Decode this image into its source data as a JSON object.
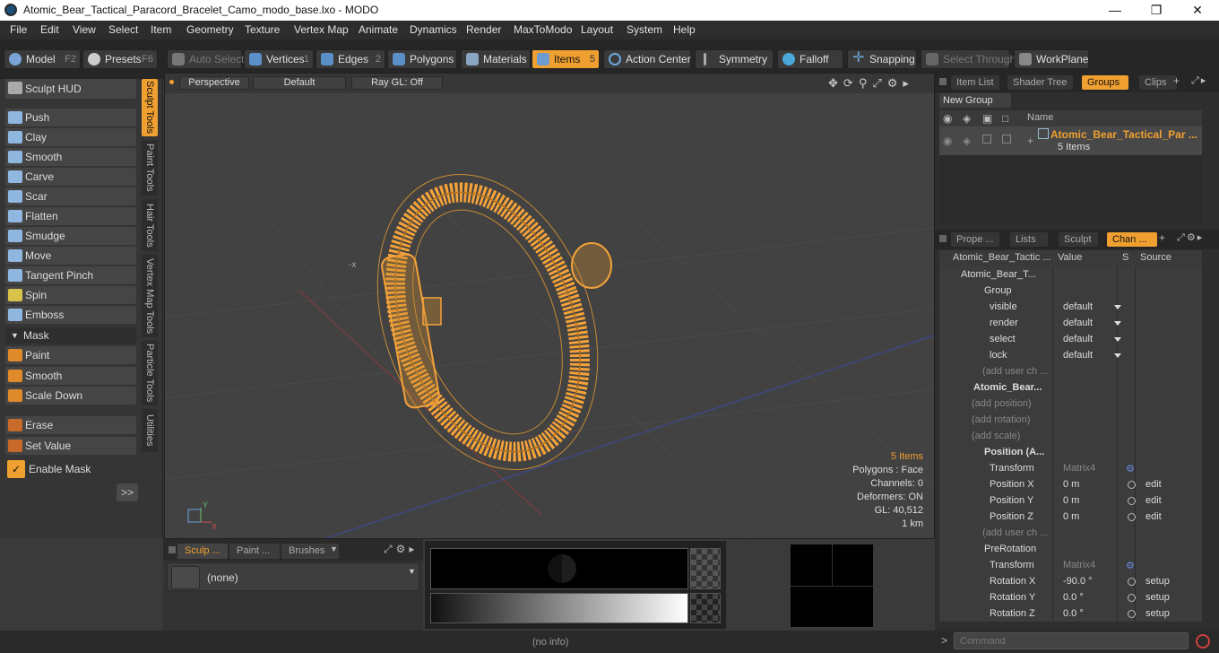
{
  "window": {
    "title": "Atomic_Bear_Tactical_Paracord_Bracelet_Camo_modo_base.lxo - MODO"
  },
  "menu": [
    "File",
    "Edit",
    "View",
    "Select",
    "Item",
    "Geometry",
    "Texture",
    "Vertex Map",
    "Animate",
    "Dynamics",
    "Render",
    "MaxToModo",
    "Layout",
    "System",
    "Help"
  ],
  "toolbar": {
    "model": "Model",
    "model_key": "F2",
    "presets": "Presets",
    "presets_key": "F6",
    "auto_select": "Auto Select",
    "vertices": "Vertices",
    "vertices_key": "1",
    "edges": "Edges",
    "edges_key": "2",
    "polygons": "Polygons",
    "materials": "Materials",
    "items": "Items",
    "items_key": "5",
    "action_center": "Action Center",
    "symmetry": "Symmetry",
    "falloff": "Falloff",
    "snapping": "Snapping",
    "select_through": "Select Through",
    "workplane": "WorkPlane"
  },
  "left": {
    "sculpt_hud": "Sculpt HUD",
    "tools": [
      "Push",
      "Clay",
      "Smooth",
      "Carve",
      "Scar",
      "Flatten",
      "Smudge",
      "Move",
      "Tangent Pinch",
      "Spin",
      "Emboss"
    ],
    "mask_header": "Mask",
    "mask_tools": [
      "Paint",
      "Smooth",
      "Scale Down"
    ],
    "erase": "Erase",
    "set_value": "Set Value",
    "enable_mask": "Enable Mask",
    "expand": ">>",
    "vtabs": [
      "Sculpt Tools",
      "Paint Tools",
      "Hair Tools",
      "Vertex Map Tools",
      "Particle Tools",
      "Utilities"
    ]
  },
  "viewport": {
    "perspective": "Perspective",
    "default": "Default",
    "raygl": "Ray GL: Off",
    "info": {
      "items": "5 Items",
      "polygons": "Polygons : Face",
      "channels": "Channels: 0",
      "deformers": "Deformers: ON",
      "gl": "GL: 40,512",
      "scale": "1 km"
    }
  },
  "bottom": {
    "tabs": [
      "Sculp ...",
      "Paint ...",
      "Brushes"
    ],
    "brush_value": "(none)"
  },
  "status": {
    "info": "(no info)",
    "command_placeholder": "Command"
  },
  "groups_panel": {
    "tabs": [
      "Item List",
      "Shader Tree",
      "Groups",
      "Clips"
    ],
    "new_group": "New Group",
    "col_name": "Name",
    "group_name": "Atomic_Bear_Tactical_Par ...",
    "group_count": "5 Items"
  },
  "channels_panel": {
    "tabs": [
      "Prope ...",
      "Lists",
      "Sculpt",
      "Chan ..."
    ],
    "header": {
      "name": "Atomic_Bear_Tactic ...",
      "value": "Value",
      "s": "S",
      "source": "Source"
    },
    "rows": [
      {
        "name": "Atomic_Bear_T...",
        "value": "",
        "source": ""
      },
      {
        "name": "Group",
        "value": "",
        "source": ""
      },
      {
        "name": "visible",
        "value": "default",
        "source": ""
      },
      {
        "name": "render",
        "value": "default",
        "source": ""
      },
      {
        "name": "select",
        "value": "default",
        "source": ""
      },
      {
        "name": "lock",
        "value": "default",
        "source": ""
      },
      {
        "name": "(add user ch ...",
        "value": "",
        "source": ""
      },
      {
        "name": "Atomic_Bear...",
        "value": "",
        "source": ""
      },
      {
        "name": "(add position)",
        "value": "",
        "source": ""
      },
      {
        "name": "(add rotation)",
        "value": "",
        "source": ""
      },
      {
        "name": "(add scale)",
        "value": "",
        "source": ""
      },
      {
        "name": "Position (A...",
        "value": "",
        "source": ""
      },
      {
        "name": "Transform",
        "value": "Matrix4",
        "source": ""
      },
      {
        "name": "Position X",
        "value": "0 m",
        "source": "edit"
      },
      {
        "name": "Position Y",
        "value": "0 m",
        "source": "edit"
      },
      {
        "name": "Position Z",
        "value": "0 m",
        "source": "edit"
      },
      {
        "name": "(add user ch ...",
        "value": "",
        "source": ""
      },
      {
        "name": "PreRotation",
        "value": "",
        "source": ""
      },
      {
        "name": "Transform",
        "value": "Matrix4",
        "source": ""
      },
      {
        "name": "Rotation X",
        "value": "-90.0 °",
        "source": "setup"
      },
      {
        "name": "Rotation Y",
        "value": "0.0 °",
        "source": "setup"
      },
      {
        "name": "Rotation Z",
        "value": "0.0 °",
        "source": "setup"
      }
    ]
  },
  "colors": {
    "accent": "#f0a030",
    "bg": "#3a3a3a",
    "viewport": "#424242"
  }
}
